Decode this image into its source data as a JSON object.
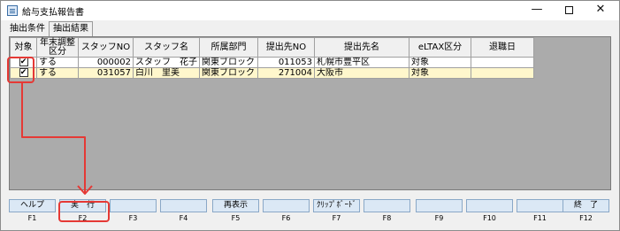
{
  "window": {
    "title": "給与支払報告書"
  },
  "tabs": [
    {
      "label": "抽出条件"
    },
    {
      "label": "抽出結果"
    }
  ],
  "grid": {
    "columns": [
      "対象",
      "年末調整区分",
      "スタッフNO",
      "スタッフ名",
      "所属部門",
      "提出先NO",
      "提出先名",
      "eLTAX区分",
      "退職日"
    ],
    "rows": [
      {
        "checked": "✔",
        "nenmatsu": "する",
        "staff_no": "000002",
        "staff_name": "スタッフ　花子",
        "dept": "関東ブロック",
        "teishutsu_no": "011053",
        "teishutsu_name": "札幌市豊平区",
        "eltax": "対象",
        "taishoku": ""
      },
      {
        "checked": "✔",
        "nenmatsu": "する",
        "staff_no": "031057",
        "staff_name": "白川　里美",
        "dept": "関東ブロック",
        "teishutsu_no": "271004",
        "teishutsu_name": "大阪市",
        "eltax": "対象",
        "taishoku": ""
      }
    ]
  },
  "fkeys": [
    {
      "label": "ヘルプ",
      "key": "F1"
    },
    {
      "label": "実　行",
      "key": "F2"
    },
    {
      "label": "",
      "key": "F3"
    },
    {
      "label": "",
      "key": "F4"
    },
    {
      "label": "再表示",
      "key": "F5"
    },
    {
      "label": "",
      "key": "F6"
    },
    {
      "label": "ｸﾘｯﾌﾟﾎﾞｰﾄﾞ",
      "key": "F7"
    },
    {
      "label": "",
      "key": "F8"
    },
    {
      "label": "",
      "key": "F9"
    },
    {
      "label": "",
      "key": "F10"
    },
    {
      "label": "",
      "key": "F11"
    },
    {
      "label": "終　了",
      "key": "F12"
    }
  ],
  "annotation_color": "#e53935"
}
